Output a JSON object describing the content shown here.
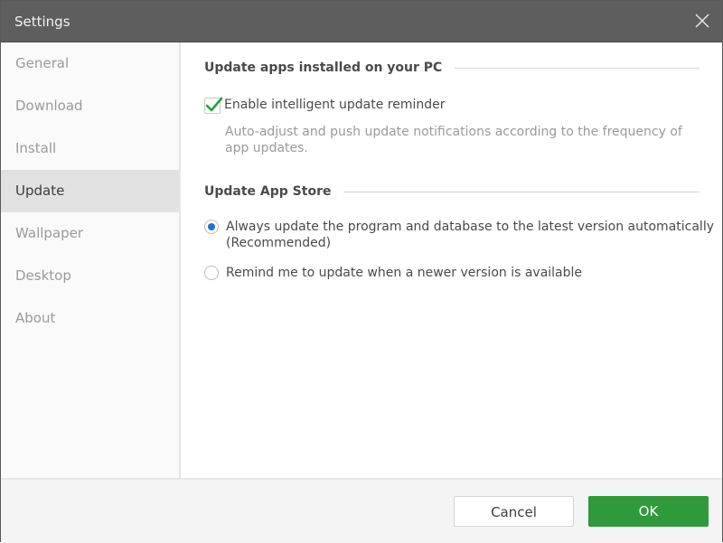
{
  "window": {
    "title": "Settings"
  },
  "sidebar": {
    "items": [
      {
        "label": "General",
        "active": false
      },
      {
        "label": "Download",
        "active": false
      },
      {
        "label": "Install",
        "active": false
      },
      {
        "label": "Update",
        "active": true
      },
      {
        "label": "Wallpaper",
        "active": false
      },
      {
        "label": "Desktop",
        "active": false
      },
      {
        "label": "About",
        "active": false
      }
    ]
  },
  "content": {
    "section1": {
      "heading": "Update apps installed on your PC",
      "checkbox": {
        "label": "Enable intelligent update reminder",
        "checked": true
      },
      "description": "Auto-adjust and push update notifications according to the frequency of app updates."
    },
    "section2": {
      "heading": "Update App Store",
      "options": [
        {
          "label_line1": "Always update the program and database to the latest version automatically",
          "label_line2": "(Recommended)",
          "selected": true
        },
        {
          "label_line1": "Remind me to update when a newer version is available",
          "selected": false
        }
      ]
    }
  },
  "footer": {
    "cancel_label": "Cancel",
    "ok_label": "OK"
  },
  "colors": {
    "accent_green": "#2e9a3a",
    "radio_blue": "#1e6fd9",
    "check_green": "#22a33a",
    "titlebar": "#5e5e5e"
  }
}
